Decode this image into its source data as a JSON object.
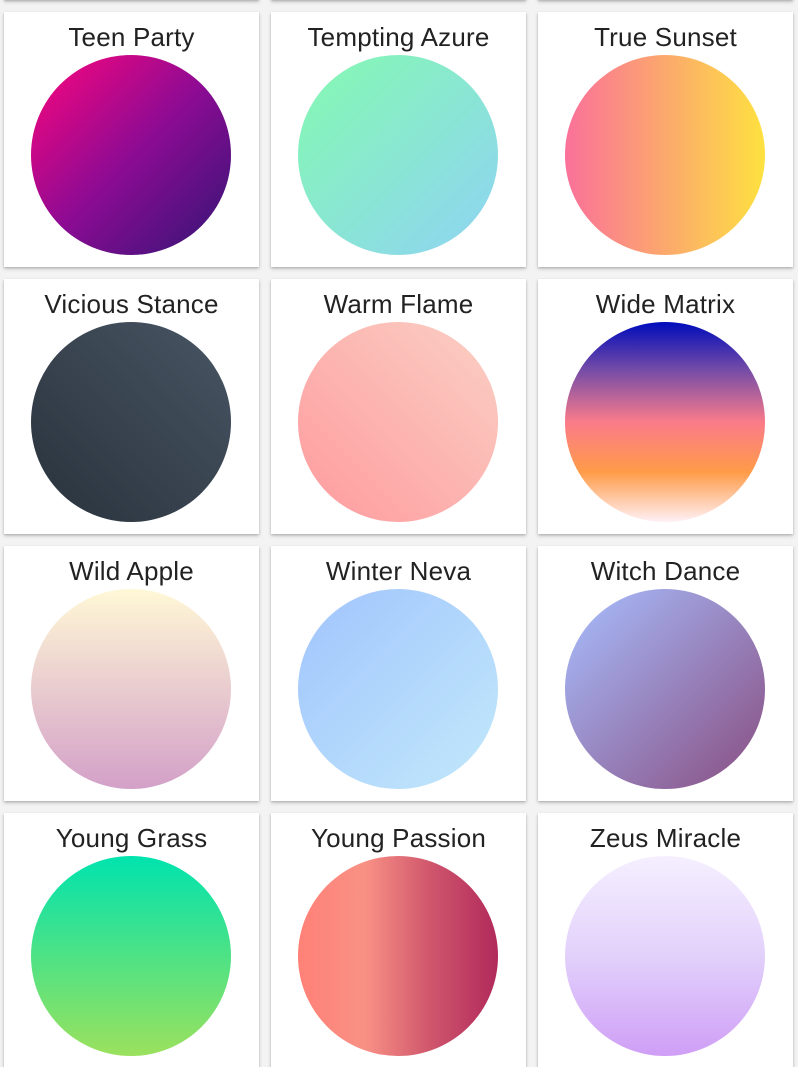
{
  "gradients": [
    {
      "name": "",
      "colors": [
        "#e0e0e0",
        "#eeeeee"
      ],
      "dir": "to bottom",
      "visible": false
    },
    {
      "name": "",
      "colors": [
        "#e0e0e0",
        "#eeeeee"
      ],
      "dir": "to bottom",
      "visible": false
    },
    {
      "name": "",
      "colors": [
        "#e0e0e0",
        "#eeeeee"
      ],
      "dir": "to bottom",
      "visible": false
    },
    {
      "name": "Teen Party",
      "colors": [
        "#ff057c",
        "#8d0b93",
        "#321575"
      ],
      "dir": "to bottom right"
    },
    {
      "name": "Tempting Azure",
      "colors": [
        "#84fab0",
        "#8fd3f4"
      ],
      "dir": "to bottom right"
    },
    {
      "name": "True Sunset",
      "colors": [
        "#fa709a",
        "#fee140"
      ],
      "dir": "to right"
    },
    {
      "name": "Vicious Stance",
      "colors": [
        "#29323c",
        "#485563"
      ],
      "dir": "to top right"
    },
    {
      "name": "Warm Flame",
      "colors": [
        "#ff9a9e",
        "#fad0c4"
      ],
      "dir": "to top right"
    },
    {
      "name": "Wide Matrix",
      "colors": [
        "#000cbb",
        "#7a4ea6",
        "#fa7b8a",
        "#ff9b48",
        "#fff0f5"
      ],
      "dir": "to bottom"
    },
    {
      "name": "Wild Apple",
      "colors": [
        "#fff8d6",
        "#d3a0c8"
      ],
      "dir": "to bottom"
    },
    {
      "name": "Winter Neva",
      "colors": [
        "#a1c4fd",
        "#c2e9fb"
      ],
      "dir": "to bottom right"
    },
    {
      "name": "Witch Dance",
      "colors": [
        "#a8bfff",
        "#884d80"
      ],
      "dir": "to bottom right"
    },
    {
      "name": "Young Grass",
      "colors": [
        "#00e3ae",
        "#9be15d"
      ],
      "dir": "to bottom"
    },
    {
      "name": "Young Passion",
      "colors": [
        "#ff8177",
        "#f99185",
        "#cf556c",
        "#b12a5b"
      ],
      "dir": "to right"
    },
    {
      "name": "Zeus Miracle",
      "colors": [
        "#f5efff",
        "#e2d1fb",
        "#cf9ef6"
      ],
      "dir": "to bottom"
    }
  ]
}
